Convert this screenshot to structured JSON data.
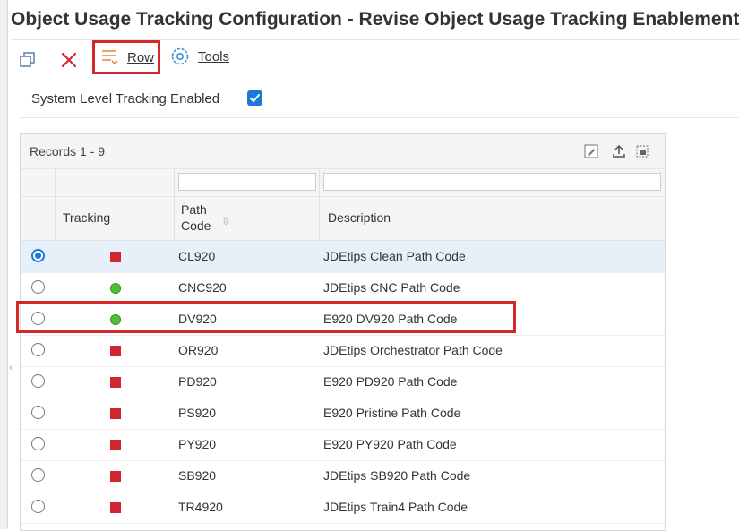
{
  "window": {
    "title": "Object Usage Tracking Configuration - Revise Object Usage Tracking Enablement"
  },
  "toolbar": {
    "copy_icon": "copy-icon",
    "close_icon": "close-icon",
    "row_label": "Row",
    "tools_label": "Tools"
  },
  "system": {
    "label": "System Level Tracking Enabled",
    "checked": true
  },
  "grid": {
    "records_label": "Records 1 - 9",
    "columns": {
      "tracking": "Tracking",
      "path_code_line1": "Path",
      "path_code_line2": "Code",
      "description": "Description"
    },
    "rows": [
      {
        "selected": true,
        "tracking": "red",
        "path_code": "CL920",
        "description": "JDEtips Clean Path Code"
      },
      {
        "selected": false,
        "tracking": "green",
        "path_code": "CNC920",
        "description": "JDEtips CNC Path Code"
      },
      {
        "selected": false,
        "tracking": "green",
        "path_code": "DV920",
        "description": "E920 DV920 Path Code"
      },
      {
        "selected": false,
        "tracking": "red",
        "path_code": "OR920",
        "description": "JDEtips Orchestrator Path Code"
      },
      {
        "selected": false,
        "tracking": "red",
        "path_code": "PD920",
        "description": "E920 PD920  Path Code"
      },
      {
        "selected": false,
        "tracking": "red",
        "path_code": "PS920",
        "description": "E920 Pristine Path Code"
      },
      {
        "selected": false,
        "tracking": "red",
        "path_code": "PY920",
        "description": "E920 PY920 Path Code"
      },
      {
        "selected": false,
        "tracking": "red",
        "path_code": "SB920",
        "description": "JDEtips SB920 Path Code"
      },
      {
        "selected": false,
        "tracking": "red",
        "path_code": "TR4920",
        "description": "JDEtips Train4 Path Code"
      }
    ]
  },
  "colors": {
    "accent": "#1b78d8",
    "highlight_border": "#d42727",
    "status_red": "#d0262f",
    "status_green": "#4fbf35"
  }
}
